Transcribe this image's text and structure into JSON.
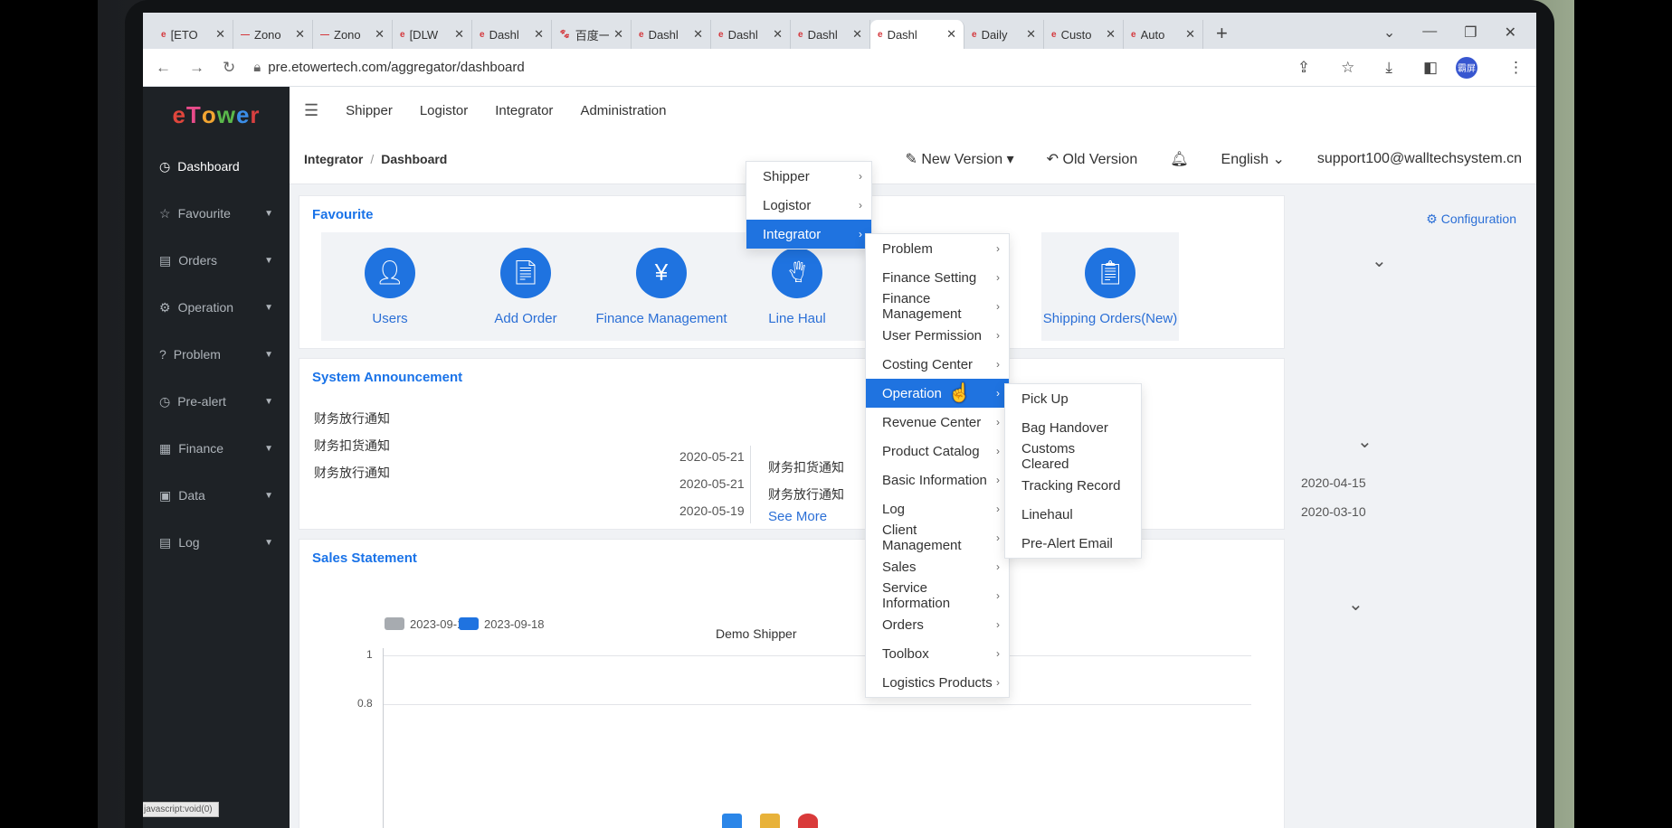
{
  "browser": {
    "tabs": [
      {
        "favicon": "eTower",
        "title": "[ETO",
        "active": false
      },
      {
        "favicon": "—",
        "title": "Zono",
        "active": false
      },
      {
        "favicon": "—",
        "title": "Zono",
        "active": false
      },
      {
        "favicon": "eTower",
        "title": "[DLW",
        "active": false
      },
      {
        "favicon": "eTower",
        "title": "Dashl",
        "active": false
      },
      {
        "favicon": "baidu",
        "title": "百度一",
        "active": false
      },
      {
        "favicon": "eTower",
        "title": "Dashl",
        "active": false
      },
      {
        "favicon": "eTower",
        "title": "Dashl",
        "active": false
      },
      {
        "favicon": "eTower",
        "title": "Dashl",
        "active": false
      },
      {
        "favicon": "eTower",
        "title": "Dashl",
        "active": true
      },
      {
        "favicon": "eTower",
        "title": "Daily",
        "active": false
      },
      {
        "favicon": "eTower",
        "title": "Custo",
        "active": false
      },
      {
        "favicon": "eTower",
        "title": "Auto",
        "active": false
      }
    ],
    "url": "pre.etowertech.com/aggregator/dashboard",
    "profile_text": "霸屏"
  },
  "app": {
    "logo": [
      "e",
      "T",
      "o",
      "w",
      "e",
      "r"
    ],
    "sidebar": [
      {
        "label": "Dashboard",
        "icon": "dashboard-icon",
        "has_arrow": false
      },
      {
        "label": "Favourite",
        "icon": "star-icon",
        "has_arrow": true
      },
      {
        "label": "Orders",
        "icon": "orders-icon",
        "has_arrow": true
      },
      {
        "label": "Operation",
        "icon": "operation-icon",
        "has_arrow": true
      },
      {
        "label": "Problem",
        "icon": "problem-icon",
        "has_arrow": true
      },
      {
        "label": "Pre-alert",
        "icon": "clock-icon",
        "has_arrow": true
      },
      {
        "label": "Finance",
        "icon": "finance-icon",
        "has_arrow": true
      },
      {
        "label": "Data",
        "icon": "data-icon",
        "has_arrow": true
      },
      {
        "label": "Log",
        "icon": "log-icon",
        "has_arrow": true
      }
    ],
    "status_url": "javascript:void(0)",
    "topnav": [
      "Shipper",
      "Logistor",
      "Integrator",
      "Administration"
    ],
    "breadcrumb": [
      "Integrator",
      "Dashboard"
    ],
    "header": {
      "new_version": "New Version",
      "old_version": "Old Version",
      "language": "English",
      "user_email": "support100@walltechsystem.cn"
    },
    "favourite": {
      "title": "Favourite",
      "configuration": "Configuration",
      "tiles": [
        "Users",
        "Add Order",
        "Finance Management",
        "Line Haul",
        "Shipping Orders(New)"
      ]
    },
    "announcement": {
      "title": "System Announcement",
      "left_items": [
        "财务放行通知",
        "财务扣货通知",
        "财务放行通知"
      ],
      "dates": [
        "2020-05-21",
        "2020-05-21",
        "2020-05-19"
      ],
      "right_items": [
        "财务扣货通知",
        "财务放行通知"
      ],
      "see_more": "See More",
      "far_dates": [
        "2020-04-15",
        "2020-03-10"
      ]
    },
    "sales": {
      "title": "Sales Statement",
      "series_title": "Demo Shipper",
      "legend": [
        "2023-09-17",
        "2023-09-18"
      ],
      "legend_colors": [
        "#a7abb0",
        "#1f73e0"
      ],
      "y_ticks": [
        "1",
        "0.8"
      ]
    },
    "menu_level1": [
      "Shipper",
      "Logistor",
      "Integrator"
    ],
    "menu_level2": [
      "Problem",
      "Finance Setting",
      "Finance Management",
      "User Permission",
      "Costing Center",
      "Operation",
      "Revenue Center",
      "Product Catalog",
      "Basic Information",
      "Log",
      "Client Management",
      "Sales",
      "Service Information",
      "Orders",
      "Toolbox",
      "Logistics Products"
    ],
    "menu_level3": [
      "Pick Up",
      "Bag Handover",
      "Customs Cleared",
      "Tracking Record",
      "Linehaul",
      "Pre-Alert Email"
    ]
  }
}
